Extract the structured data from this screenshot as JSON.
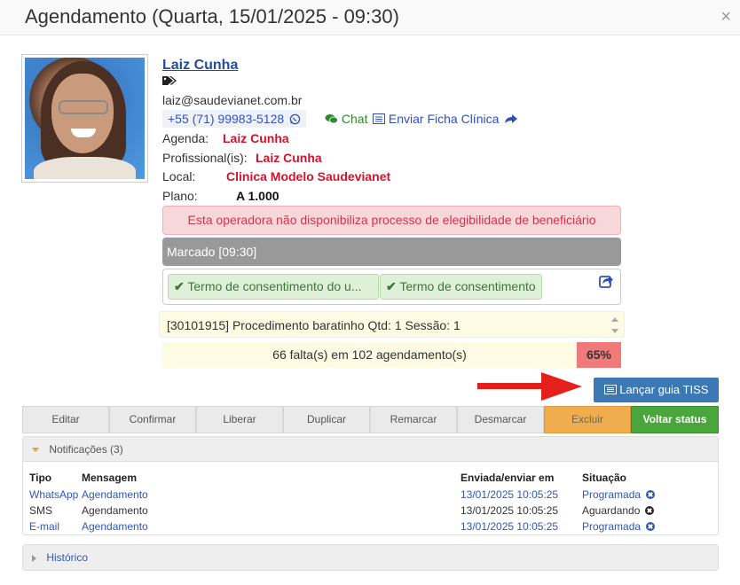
{
  "modal": {
    "title": "Agendamento (Quarta, 15/01/2025 - 09:30)",
    "close": "×"
  },
  "patient": {
    "name": "Laiz Cunha",
    "email": "laiz@saudevianet.com.br",
    "phone": "+55 (71) 99983-5128",
    "chat_label": "Chat",
    "ficha_label": "Enviar Ficha Clínica"
  },
  "details": {
    "agenda_label": "Agenda:",
    "agenda_value": "Laiz Cunha",
    "prof_label": "Profissional(is):",
    "prof_value": "Laiz Cunha",
    "local_label": "Local:",
    "local_value": "Clinica Modelo Saudevianet",
    "plano_label": "Plano:",
    "plano_value": "A 1.000"
  },
  "alert": "Esta operadora não disponibiliza processo de elegibilidade de beneficiário",
  "status": "Marcado [09:30]",
  "consents": [
    "Termo de consentimento do u...",
    "Termo de consentimento"
  ],
  "procedure": "[30101915] Procedimento baratinho Qtd: 1 Sessão: 1",
  "faltas": {
    "text": "66 falta(s) em 102 agendamento(s)",
    "percent": "65%"
  },
  "tiss_button": "Lançar guia TISS",
  "toolbar": [
    "Editar",
    "Confirmar",
    "Liberar",
    "Duplicar",
    "Remarcar",
    "Desmarcar",
    "Excluir",
    "Voltar status"
  ],
  "notifications": {
    "title": "Notificações (3)",
    "headers": [
      "Tipo",
      "Mensagem",
      "Enviada/enviar em",
      "Situação"
    ],
    "rows": [
      {
        "tipo": "WhatsApp",
        "mensagem": "Agendamento",
        "data": "13/01/2025 10:05:25",
        "situacao": "Programada"
      },
      {
        "tipo": "SMS",
        "mensagem": "Agendamento",
        "data": "13/01/2025 10:05:25",
        "situacao": "Aguardando"
      },
      {
        "tipo": "E-mail",
        "mensagem": "Agendamento",
        "data": "13/01/2025 10:05:25",
        "situacao": "Programada"
      }
    ]
  },
  "historico": "Histórico",
  "colors": {
    "accent_blue": "#3b78b4",
    "alert_red": "#d4122b",
    "success_green": "#4aa53c",
    "warning_orange": "#f0ad4e"
  }
}
